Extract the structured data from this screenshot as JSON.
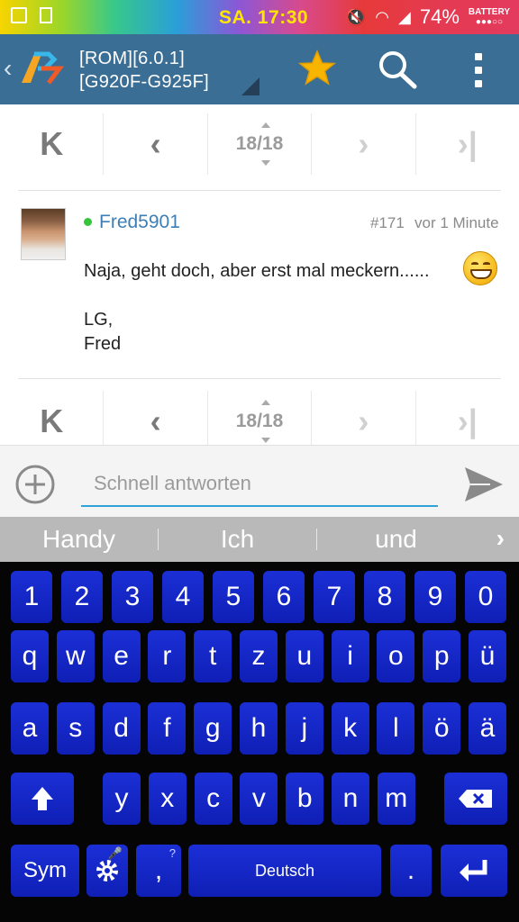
{
  "status_bar": {
    "time": "SA. 17:30",
    "battery_percent": "74%",
    "battery_label": "BATTERY"
  },
  "app_bar": {
    "title_line1": "[ROM][6.0.1]",
    "title_line2": "[G920F-G925F]"
  },
  "pagination": {
    "current": "18/18"
  },
  "post": {
    "username": "Fred5901",
    "post_number": "#171",
    "timestamp": "vor 1 Minute",
    "line1": "Naja, geht doch, aber erst mal meckern......",
    "line2": "LG,",
    "line3": "Fred"
  },
  "reply": {
    "placeholder": "Schnell antworten"
  },
  "suggestions": [
    "Handy",
    "Ich",
    "und"
  ],
  "keyboard": {
    "row1": [
      "1",
      "2",
      "3",
      "4",
      "5",
      "6",
      "7",
      "8",
      "9",
      "0"
    ],
    "row2": [
      "q",
      "w",
      "e",
      "r",
      "t",
      "z",
      "u",
      "i",
      "o",
      "p",
      "ü"
    ],
    "row3": [
      "a",
      "s",
      "d",
      "f",
      "g",
      "h",
      "j",
      "k",
      "l",
      "ö",
      "ä"
    ],
    "row4": [
      "y",
      "x",
      "c",
      "v",
      "b",
      "n",
      "m"
    ],
    "sym_label": "Sym",
    "space_label": "Deutsch",
    "comma": ",",
    "comma_hint": "?",
    "period": "."
  },
  "colors": {
    "app_bar": "#3b6e94",
    "key": "#1226c8",
    "accent": "#2fa3d8",
    "username": "#3d7fb5",
    "star": "#f7b500"
  }
}
